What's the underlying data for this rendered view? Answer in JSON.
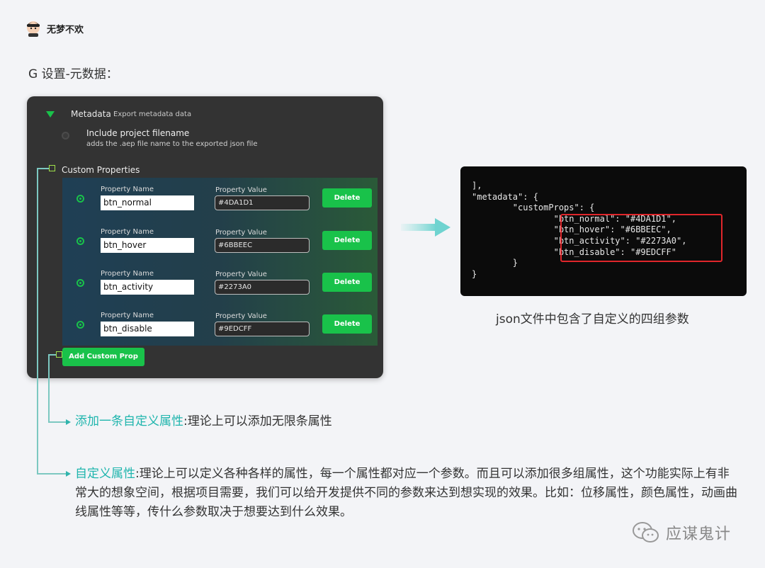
{
  "author": {
    "name": "无梦不欢"
  },
  "section_title": "G 设置-元数据：",
  "dialog": {
    "metadata_title": "Metadata",
    "metadata_desc": "Export metadata data",
    "include_label": "Include project filename",
    "include_desc": "adds the .aep file name to the exported json file",
    "custom_props_label": "Custom Properties",
    "property_name_label": "Property Name",
    "property_value_label": "Property Value",
    "delete_label": "Delete",
    "add_label": "Add Custom Prop",
    "rows": [
      {
        "name": "btn_normal",
        "value": "#4DA1D1"
      },
      {
        "name": "btn_hover",
        "value": "#6BBEEC"
      },
      {
        "name": "btn_activity",
        "value": "#2273A0"
      },
      {
        "name": "btn_disable",
        "value": "#9EDCFF"
      }
    ],
    "colors": {
      "accent_green": "#19c24a",
      "panel_bg": "#333333"
    }
  },
  "code": {
    "lines": [
      "],",
      "\"metadata\": {",
      "        \"customProps\": {",
      "                \"btn_normal\": \"#4DA1D1\",",
      "                \"btn_hover\": \"#6BBEEC\",",
      "                \"btn_activity\": \"#2273A0\",",
      "                \"btn_disable\": \"#9EDCFF\"",
      "        }",
      "}"
    ],
    "caption": "json文件中包含了自定义的四组参数",
    "highlight_color": "#e0262b"
  },
  "notes": {
    "note1_accent": "添加一条自定义属性",
    "note1_text": ":理论上可以添加无限条属性",
    "note2_accent": "自定义属性",
    "note2_text": ":理论上可以定义各种各样的属性，每一个属性都对应一个参数。而且可以添加很多组属性，这个功能实际上有非常大的想象空间，根据项目需要，我们可以给开发提供不同的参数来达到想实现的效果。比如：位移属性，颜色属性，动画曲线属性等等，传什么参数取决于想要达到什么效果。",
    "accent_color": "#1fb5ad"
  },
  "watermark": {
    "text": "应谋鬼计"
  }
}
